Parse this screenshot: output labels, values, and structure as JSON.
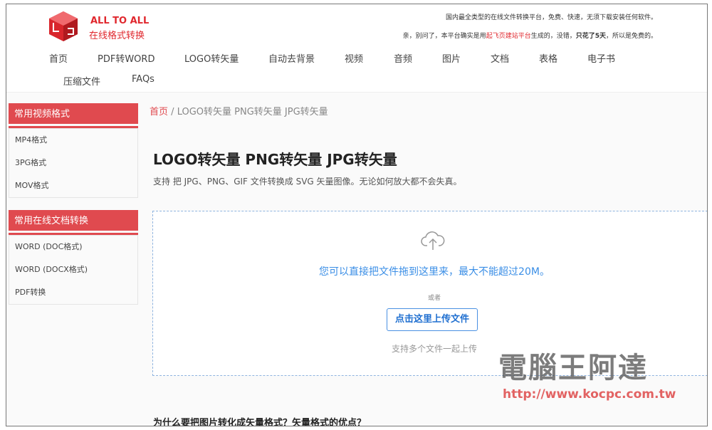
{
  "brand": {
    "line1": "ALL TO ALL",
    "line2": "在线格式转换"
  },
  "notice": {
    "line1": "国内最全类型的在线文件转换平台，免费、快速，无须下载安装任何软件。",
    "line2_a": "亲，别问了，本平台确实是用",
    "line2_link": "起飞页建站平台",
    "line2_b": "生成的，没错，",
    "line2_bold": "只花了5天",
    "line2_c": "，所以是免费的。"
  },
  "nav": [
    "首页",
    "PDF转WORD",
    "LOGO转矢量",
    "自动去背景",
    "视频",
    "音频",
    "图片",
    "文档",
    "表格",
    "电子书",
    "压缩文件",
    "FAQs"
  ],
  "sidebar": [
    {
      "title": "常用视频格式",
      "items": [
        "MP4格式",
        "3PG格式",
        "MOV格式"
      ]
    },
    {
      "title": "常用在线文档转换",
      "items": [
        "WORD (DOC格式)",
        "WORD (DOCX格式)",
        "PDF转换"
      ]
    }
  ],
  "breadcrumb": {
    "home": "首页",
    "sep": "/",
    "current": "LOGO转矢量 PNG转矢量 JPG转矢量"
  },
  "title": "LOGO转矢量 PNG转矢量  JPG转矢量",
  "subtitle": "支持 把 JPG、PNG、GIF 文件转换成 SVG 矢量图像。无论如何放大都不会失真。",
  "upload": {
    "drag_text": "您可以直接把文件拖到这里来，最大不能超过20M。",
    "or": "或者",
    "button": "点击这里上传文件",
    "hint": "支持多个文件一起上传"
  },
  "question": "为什么要把图片转化成矢量格式？矢量格式的优点？",
  "watermark": {
    "name": "電腦王阿達",
    "url": "http://www.kocpc.com.tw"
  }
}
